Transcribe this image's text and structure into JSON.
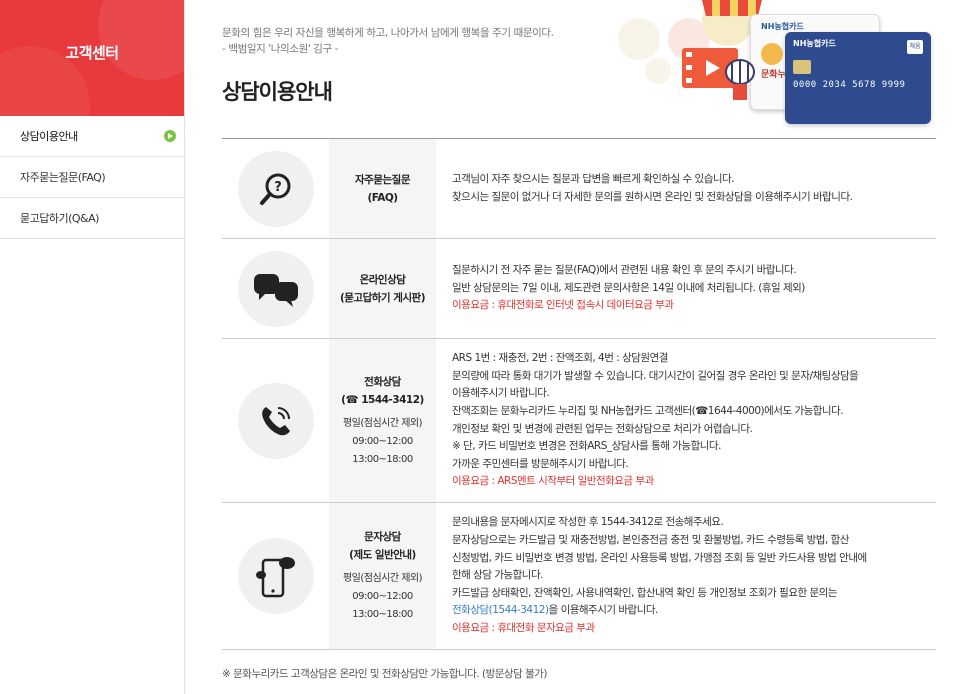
{
  "sidebar": {
    "title": "고객센터",
    "items": [
      {
        "label": "상담이용안내"
      },
      {
        "label": "자주묻는질문(FAQ)"
      },
      {
        "label": "묻고답하기(Q&A)"
      }
    ]
  },
  "header": {
    "quote_line1": "문화의 힘은 우리 자신을 행복하게 하고, 나아가서 남에게 행복을 주기 때문이다.",
    "quote_line2": "- 백범일지 '나의소원' 김구 -",
    "title": "상담이용안내"
  },
  "illustration": {
    "card_brand": "NH농협카드",
    "card_badge": "채움",
    "card_number": "0000 2034 5678 9999",
    "card2_label": "문화누리"
  },
  "rows": [
    {
      "icon": "question-search-icon",
      "title": "자주묻는질문",
      "title2": "(FAQ)",
      "lines": [
        "고객님이 자주 찾으시는 질문과 답변을 빠르게 확인하실 수 있습니다.",
        "찾으시는 질문이 없거나 더 자세한 문의를 원하시면 온라인 및 전화상담을 이용해주시기 바랍니다."
      ]
    },
    {
      "icon": "chat-bubbles-icon",
      "title": "온라인상담",
      "title2": "(묻고답하기 게시판)",
      "lines": [
        "질문하시기 전 자주 묻는 질문(FAQ)에서 관련된 내용 확인 후 문의 주시기 바랍니다.",
        "일반 상담문의는 7일 이내, 제도관련 문의사항은 14일 이내에 처리됩니다. (휴일 제외)"
      ],
      "fee": "이용요금 : 휴대전화로 인터넷 접속시 데이터요금 부과"
    },
    {
      "icon": "phone-icon",
      "title": "전화상담",
      "title2": "(☎ 1544-3412)",
      "hours": [
        "평일(점심시간 제외)",
        "09:00~12:00",
        "13:00~18:00"
      ],
      "lines": [
        "ARS 1번 : 재충전, 2번 : 잔액조회, 4번 : 상담원연결",
        "문의량에 따라 통화 대기가 발생할 수 있습니다. 대기시간이 길어질 경우 온라인 및 문자/채팅상담을",
        "이용해주시기 바랍니다.",
        "잔액조회는 문화누리카드 누리집 및 NH농협카드 고객센터(☎1644-4000)에서도 가능합니다.",
        "개인정보 확인 및 변경에 관련된 업무는 전화상담으로 처리가 어렵습니다.",
        "※ 단, 카드 비밀번호 변경은 전화ARS_상담사를 통해 가능합니다.",
        "가까운 주민센터를 방문해주시기 바랍니다."
      ],
      "fee": "이용요금 : ARS멘트 시작부터 일반전화요금 부과"
    },
    {
      "icon": "mobile-message-icon",
      "title": "문자상담",
      "title2": "(제도 일반안내)",
      "hours": [
        "평일(점심시간 제외)",
        "09:00~12:00",
        "13:00~18:00"
      ],
      "lines": [
        "문의내용을 문자메시지로 작성한 후 1544-3412로 전송해주세요.",
        "문자상담으로는 카드발급 및 재충전방법, 본인충전금 충전 및 환불방법, 카드 수령등록 방법, 합산",
        "신청방법, 카드 비밀번호 변경 방법, 온라인 사용등록 방법, 가맹점 조회 등 일반 카드사용 방법 안내에",
        "한해 상담 가능합니다.",
        "카드발급 상태확인, 잔액확인, 사용내역확인, 합산내역 확인 등 개인정보 조회가 필요한 문의는"
      ],
      "link": "전화상담(1544-3412)",
      "link_suffix": "을 이용해주시기 바랍니다.",
      "fee": "이용요금 : 휴대전화 문자요금 부과"
    }
  ],
  "note": "※ 문화누리카드 고객상담은 온라인 및 전화상담만 가능합니다. (방문상담 불가)"
}
